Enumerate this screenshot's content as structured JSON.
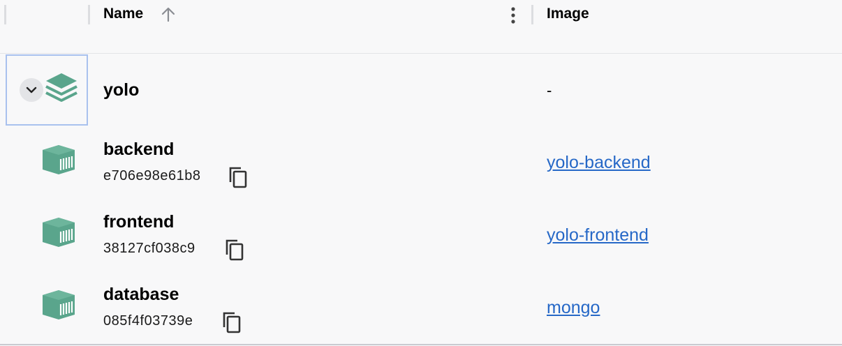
{
  "columns": {
    "name_label": "Name",
    "image_label": "Image",
    "sort_icon": "arrow-up-icon",
    "menu_icon": "kebab-menu-icon"
  },
  "group": {
    "name": "yolo",
    "image": "-",
    "expand_icon": "chevron-down-icon",
    "icon": "stack-layers-icon"
  },
  "containers": [
    {
      "name": "backend",
      "id": "e706e98e61b8",
      "image": "yolo-backend"
    },
    {
      "name": "frontend",
      "id": "38127cf038c9",
      "image": "yolo-frontend"
    },
    {
      "name": "database",
      "id": "085f4f03739e",
      "image": "mongo"
    }
  ],
  "colors": {
    "accent_green": "#5aa58c",
    "link_blue": "#2668c7",
    "selection_border": "#a9c1ee",
    "background": "#f8f8f9"
  }
}
